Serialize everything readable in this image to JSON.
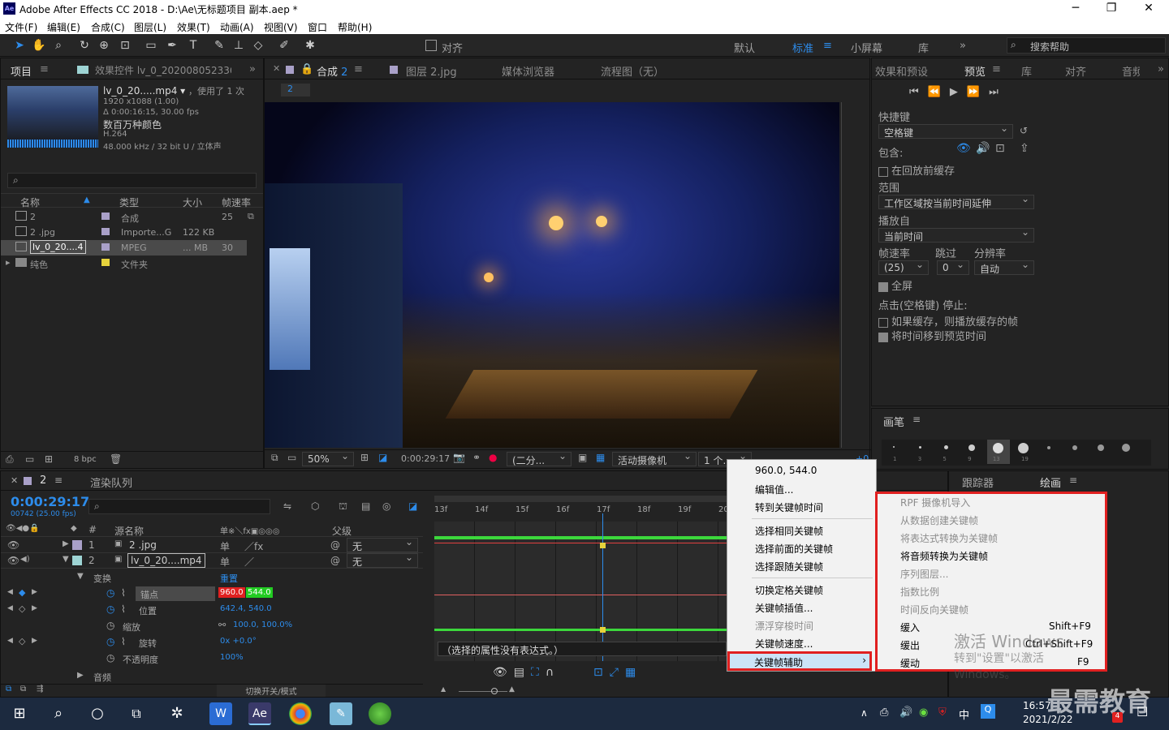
{
  "window": {
    "title": "Adobe After Effects CC 2018 - D:\\Ae\\无标题项目 副本.aep *",
    "logo": "Ae",
    "minimize": "─",
    "maximize": "❐",
    "close": "✕"
  },
  "menu": [
    "文件(F)",
    "编辑(E)",
    "合成(C)",
    "图层(L)",
    "效果(T)",
    "动画(A)",
    "视图(V)",
    "窗口",
    "帮助(H)"
  ],
  "toolbar": {
    "snap_label": "对齐",
    "workspaces": [
      "默认",
      "标准",
      "小屏幕",
      "库"
    ],
    "active_workspace": "标准",
    "search_placeholder": "搜索帮助",
    "more": "»"
  },
  "project_panel": {
    "tabs": [
      "项目",
      "效果控件 lv_0_2020080523360…"
    ],
    "info": {
      "name": "lv_0_20.....mp4",
      "used": "，使用了 1 次",
      "res": "1920 x1088 (1.00)",
      "dur": "Δ 0:00:16:15, 30.00 fps",
      "colors": "数百万种颜色",
      "codec": "H.264",
      "audio": "48.000 kHz / 32 bit U / 立体声"
    },
    "search_placeholder": "",
    "columns": [
      "名称",
      "类型",
      "大小",
      "帧速率"
    ],
    "rows": [
      {
        "name": "2",
        "type": "合成",
        "size": "",
        "fps": "25",
        "color": "#a9a0c8"
      },
      {
        "name": "2 .jpg",
        "type": "Importe...G",
        "size": "122 KB",
        "fps": "",
        "color": "#a9a0c8"
      },
      {
        "name": "lv_0_20....4",
        "type": "MPEG",
        "size": "... MB",
        "fps": "30",
        "color": "#a9a0c8"
      },
      {
        "name": "纯色",
        "type": "文件夹",
        "size": "",
        "fps": "",
        "color": "#e6d23c"
      }
    ],
    "bpc": "8 bpc"
  },
  "comp_panel": {
    "tabs": [
      "合成 2",
      "图层 2.jpg",
      "媒体浏览器",
      "流程图（无）"
    ],
    "breadcrumb": "2",
    "zoom": "50%",
    "time": "0:00:29:17",
    "res": "(二分...",
    "camera": "活动摄像机",
    "views": "1 个...",
    "offset": "+0.0"
  },
  "right_panel": {
    "tabs": [
      "效果和预设",
      "预览",
      "库",
      "对齐",
      "音频"
    ],
    "shortcut_label": "快捷键",
    "shortcut_val": "空格键",
    "include_label": "包含:",
    "cache_before": "在回放前缓存",
    "range_label": "范围",
    "range_val": "工作区域按当前时间延伸",
    "play_from_label": "播放自",
    "play_from_val": "当前时间",
    "fps_label": "帧速率",
    "fps_val": "(25)",
    "skip_label": "跳过",
    "skip_val": "0",
    "res_label": "分辨率",
    "res_val": "自动",
    "fullscreen": "全屏",
    "stop_label": "点击(空格键) 停止:",
    "opt1": "如果缓存，则播放缓存的帧",
    "opt2": "将时间移到预览时间",
    "brush_label": "画笔",
    "tracker": "跟踪器",
    "paint": "绘画",
    "brush_sizes": [
      "1",
      "3",
      "5",
      "9",
      "13",
      "19",
      "5",
      "9",
      "13",
      "17"
    ]
  },
  "timeline": {
    "tabs": [
      "2",
      "渲染队列"
    ],
    "timecode": "0:00:29:17",
    "frames": "00742 (25.00 fps)",
    "columns": {
      "src": "源名称",
      "parent": "父级"
    },
    "layers": [
      {
        "num": "1",
        "name": "2 .jpg",
        "parent": "无",
        "color": "#a9a0c8"
      },
      {
        "num": "2",
        "name": "lv_0_20....mp4",
        "parent": "无",
        "color": "#9ed4d4"
      }
    ],
    "transform": "变换",
    "reset": "重置",
    "props": [
      {
        "name": "锚点",
        "val1": "960.0",
        "val2": "544.0"
      },
      {
        "name": "位置",
        "val": "642.4, 540.0"
      },
      {
        "name": "缩放",
        "val": "100.0, 100.0%"
      },
      {
        "name": "旋转",
        "val": "0x +0.0°"
      },
      {
        "name": "不透明度",
        "val": "100%"
      }
    ],
    "audio": "音频",
    "ruler": [
      "13f",
      "14f",
      "15f",
      "16f",
      "17f",
      "18f",
      "19f",
      "20"
    ],
    "expr_msg": "（选择的属性没有表达式。）",
    "toggle_mode": "切换开关/模式"
  },
  "context_menu": {
    "items": [
      "960.0, 544.0",
      "编辑值...",
      "转到关键帧时间",
      "选择相同关键帧",
      "选择前面的关键帧",
      "选择跟随关键帧",
      "切换定格关键帧",
      "关键帧插值...",
      "漂浮穿梭时间",
      "关键帧速度...",
      "关键帧辅助"
    ],
    "disabled": [
      8
    ]
  },
  "submenu": {
    "items": [
      {
        "label": "RPF 摄像机导入",
        "shortcut": "",
        "disabled": true
      },
      {
        "label": "从数据创建关键帧",
        "shortcut": "",
        "disabled": true
      },
      {
        "label": "将表达式转换为关键帧",
        "shortcut": "",
        "disabled": true
      },
      {
        "label": "将音频转换为关键帧",
        "shortcut": "",
        "disabled": false
      },
      {
        "label": "序列图层...",
        "shortcut": "",
        "disabled": true
      },
      {
        "label": "指数比例",
        "shortcut": "",
        "disabled": true
      },
      {
        "label": "时间反向关键帧",
        "shortcut": "",
        "disabled": true
      },
      {
        "label": "缓入",
        "shortcut": "Shift+F9",
        "disabled": false
      },
      {
        "label": "缓出",
        "shortcut": "Ctrl+Shift+F9",
        "disabled": false
      },
      {
        "label": "缓动",
        "shortcut": "F9",
        "disabled": false
      }
    ]
  },
  "watermark": {
    "line1": "激活 Windows",
    "line2": "转到\"设置\"以激活 Windows。",
    "brand": "最需教育"
  },
  "taskbar": {
    "time": "16:57",
    "date": "2021/2/22",
    "ime": "中",
    "badge": "4"
  }
}
